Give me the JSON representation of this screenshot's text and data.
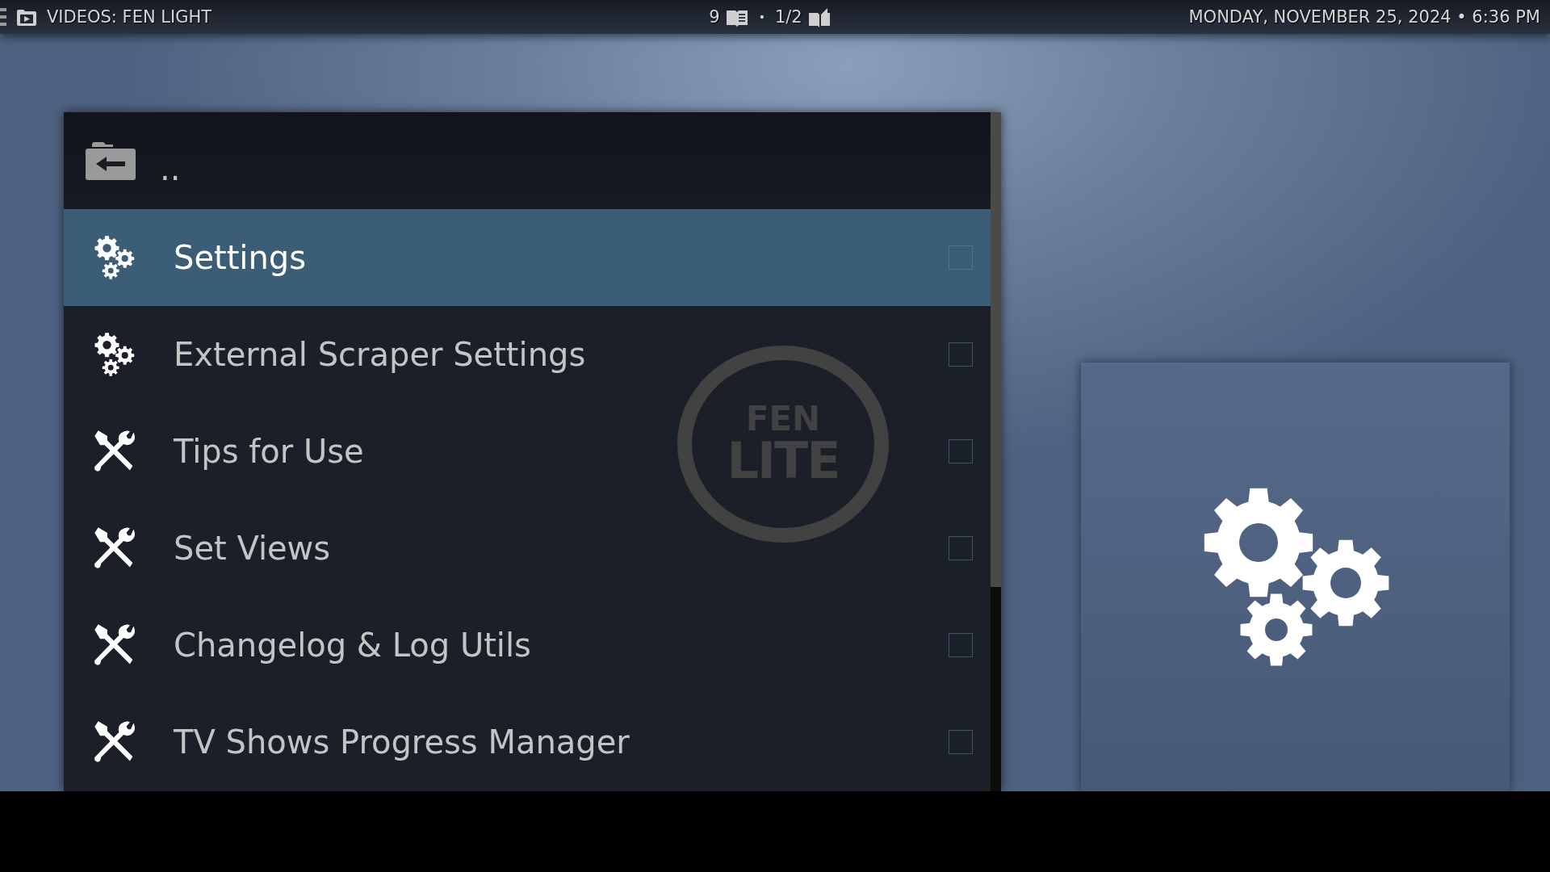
{
  "top_bar": {
    "title": "VIDEOS: FEN LIGHT",
    "item_count": "9",
    "separator": "•",
    "page": "1/2",
    "datetime": "MONDAY, NOVEMBER 25, 2024 • 6:36 PM"
  },
  "list": {
    "parent": {
      "label": ".."
    },
    "items": [
      {
        "label": "Settings",
        "kind": "gears",
        "selected": true,
        "checked": false
      },
      {
        "label": "External Scraper Settings",
        "kind": "gears",
        "selected": false,
        "checked": false
      },
      {
        "label": "Tips for Use",
        "kind": "tools",
        "selected": false,
        "checked": false
      },
      {
        "label": "Set Views",
        "kind": "tools",
        "selected": false,
        "checked": false
      },
      {
        "label": "Changelog & Log Utils",
        "kind": "tools",
        "selected": false,
        "checked": false
      },
      {
        "label": "TV Shows Progress Manager",
        "kind": "tools",
        "selected": false,
        "checked": false
      }
    ]
  },
  "logo": {
    "line_1": "FEN",
    "line_2": "LITE"
  }
}
